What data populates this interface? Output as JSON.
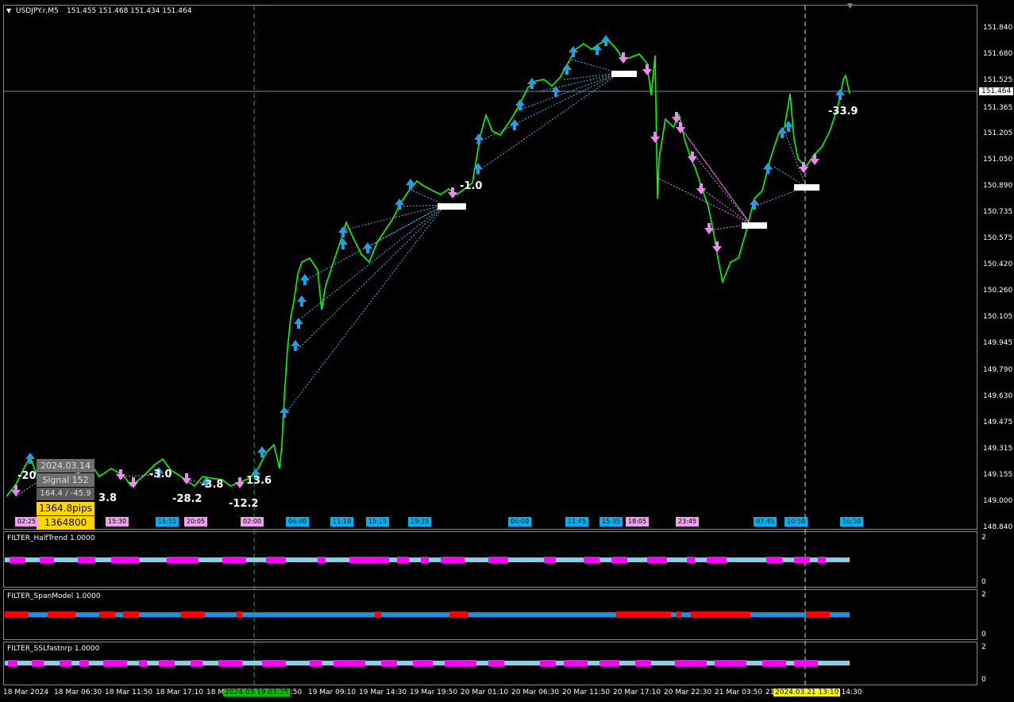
{
  "chart_header": {
    "collapse_icon": "triangle-down-icon",
    "symbol": "USDJPY.r,M5",
    "ohlc": "151.455 151.468 151.434 151.464"
  },
  "price_axis": {
    "labels": [
      "151.840",
      "151.680",
      "151.525",
      "151.365",
      "151.205",
      "151.050",
      "150.890",
      "150.735",
      "150.575",
      "150.420",
      "150.260",
      "150.105",
      "149.945",
      "149.790",
      "149.630",
      "149.475",
      "149.315",
      "149.155",
      "149.000",
      "148.840"
    ],
    "current_price": "151.464"
  },
  "time_axis": {
    "labels": [
      "18 Mar 2024",
      "18 Mar 06:30",
      "18 Mar 11:50",
      "18 Mar 17:10",
      "18 M",
      "3:50",
      "19 Mar 09:10",
      "19 Mar 14:30",
      "19 Mar 19:50",
      "20 Mar 01:10",
      "20 Mar 06:30",
      "20 Mar 11:50",
      "20 Mar 17:10",
      "20 Mar 22:30",
      "21 Mar 03:50",
      "21",
      "r 14:30"
    ],
    "cursor_label_1": "2024.03.19 03:25",
    "cursor_label_2": "2024.03.21 13:10"
  },
  "info_panel": {
    "date": "2024.03.14",
    "signal": "Signal 152",
    "ratio": "164.4 / -45.9",
    "pips": "1364.8pips",
    "total": "1364800"
  },
  "trade_labels": [
    "-20",
    "3.8",
    "-3.0",
    "-28.2",
    "-3.8",
    "-12.2",
    "13.6",
    "-1.0",
    "-33.9"
  ],
  "bottom_tags": [
    {
      "text": "02:25",
      "color": "pink"
    },
    {
      "text": "15:30",
      "color": "pink"
    },
    {
      "text": "16:55",
      "color": "blue"
    },
    {
      "text": "20:05",
      "color": "pink"
    },
    {
      "text": "02:00",
      "color": "pink"
    },
    {
      "text": "06:40",
      "color": "blue"
    },
    {
      "text": "11:10",
      "color": "blue"
    },
    {
      "text": "15:15",
      "color": "blue"
    },
    {
      "text": "19:35",
      "color": "blue"
    },
    {
      "text": "06:00",
      "color": "blue"
    },
    {
      "text": "11:45",
      "color": "blue"
    },
    {
      "text": "15:35",
      "color": "blue"
    },
    {
      "text": "18:05",
      "color": "pink"
    },
    {
      "text": "23:45",
      "color": "pink"
    },
    {
      "text": "07:45",
      "color": "blue"
    },
    {
      "text": "10:50",
      "color": "blue"
    },
    {
      "text": "16:50",
      "color": "blue"
    }
  ],
  "subwindows": [
    {
      "label": "FILTER_HalfTrend 1.0000",
      "scale_top": "2",
      "scale_bottom": "0"
    },
    {
      "label": "FILTER_SpanModel 1.0000",
      "scale_top": "2",
      "scale_bottom": "0"
    },
    {
      "label": "FILTER_SSLfastnrp 1.0000",
      "scale_top": "2",
      "scale_bottom": "0"
    }
  ],
  "colors": {
    "background": "#000000",
    "candle_up": "#00ff00",
    "arrow_up": "#1ea0e6",
    "arrow_down": "#ee88ee",
    "filter_bull": "#87cee6",
    "filter_bear": "#ff00ff",
    "span_bull": "#1e90e0",
    "span_bear": "#ff0000",
    "cursor_line_1": "#00c000",
    "cursor_line_2": "#e6e69a",
    "info_dark": "#7f7f7f",
    "info_gold": "#ffd700"
  }
}
